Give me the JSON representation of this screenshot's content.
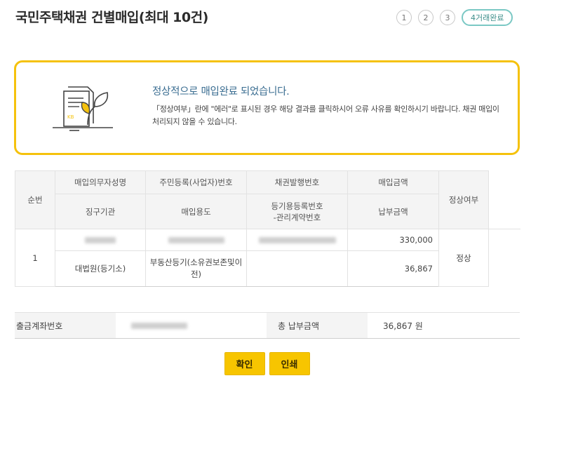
{
  "header": {
    "title": "국민주택채권 건별매입(최대 10건)",
    "steps": [
      "1",
      "2",
      "3"
    ],
    "active_step": "4거래완료"
  },
  "notice": {
    "title": "정상적으로 매입완료 되었습니다.",
    "desc": "「정상여부」란에 \"에러\"로 표시된 경우 해당 결과를 클릭하시어 오류 사유를 확인하시기 바랍니다. 채권 매입이 처리되지 않을 수 있습니다.",
    "accent_color": "#f5c20d"
  },
  "table": {
    "headers": {
      "seq": "순번",
      "buyer_name": "매입의무자성명",
      "reg_no": "주민등록(사업자)번호",
      "bond_no": "채권발행번호",
      "amount": "매입금액",
      "status": "정상여부",
      "agency": "징구기관",
      "purpose": "매입용도",
      "mgmt_no_line1": "등기용등록번호",
      "mgmt_no_line2": "-관리계약번호",
      "payment": "납부금액"
    },
    "rows": [
      {
        "seq": "1",
        "amount": "330,000",
        "agency": "대법원(등기소)",
        "purpose": "부동산등기(소유권보존및이전)",
        "payment": "36,867",
        "status": "정상"
      }
    ]
  },
  "account": {
    "label": "출금계좌번호",
    "total_label": "총 납부금액",
    "total_value": "36,867 원"
  },
  "buttons": {
    "confirm": "확인",
    "print": "인쇄"
  }
}
